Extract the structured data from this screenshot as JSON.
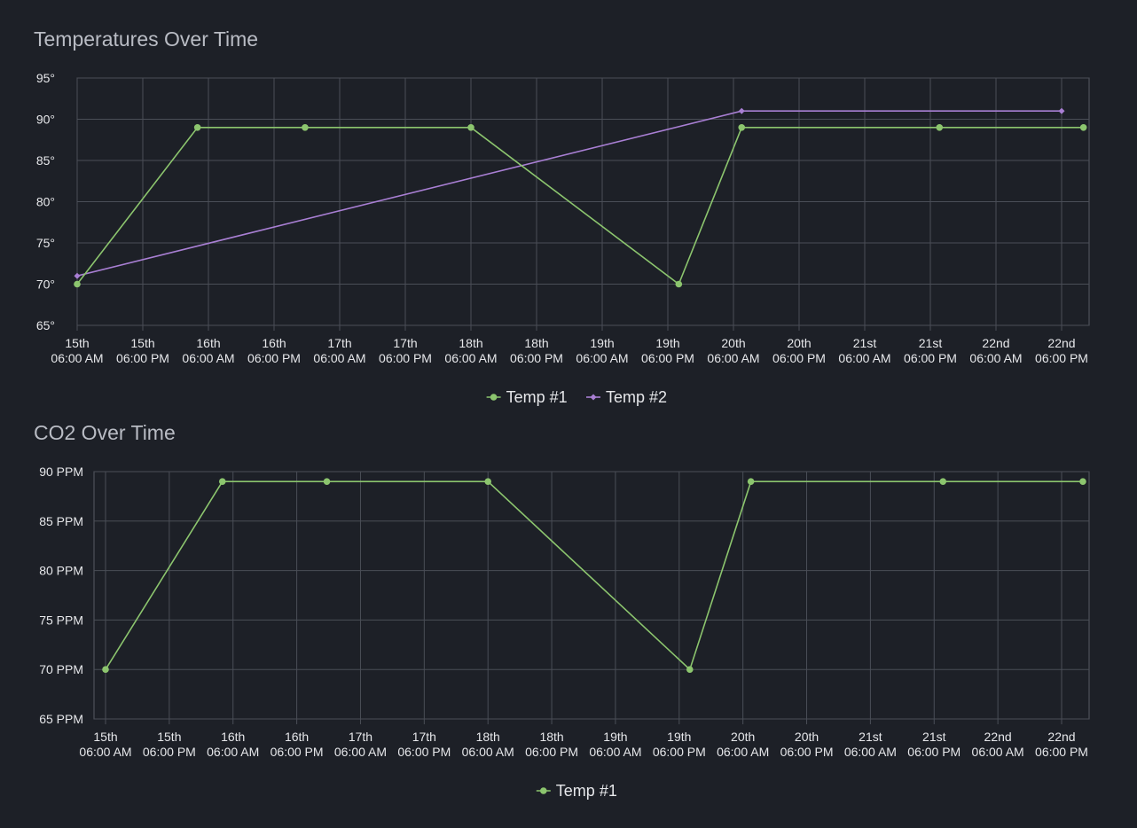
{
  "chart_data": [
    {
      "type": "line",
      "title": "Temperatures Over Time",
      "xlabel": "",
      "ylabel": "",
      "x_ticks": [
        [
          "15th",
          "06:00 AM"
        ],
        [
          "15th",
          "06:00 PM"
        ],
        [
          "16th",
          "06:00 AM"
        ],
        [
          "16th",
          "06:00 PM"
        ],
        [
          "17th",
          "06:00 AM"
        ],
        [
          "17th",
          "06:00 PM"
        ],
        [
          "18th",
          "06:00 AM"
        ],
        [
          "18th",
          "06:00 PM"
        ],
        [
          "19th",
          "06:00 AM"
        ],
        [
          "19th",
          "06:00 PM"
        ],
        [
          "20th",
          "06:00 AM"
        ],
        [
          "20th",
          "06:00 PM"
        ],
        [
          "21st",
          "06:00 AM"
        ],
        [
          "21st",
          "06:00 PM"
        ],
        [
          "22nd",
          "06:00 AM"
        ],
        [
          "22nd",
          "06:00 PM"
        ]
      ],
      "y_ticks": [
        "65°",
        "70°",
        "75°",
        "80°",
        "85°",
        "90°",
        "95°"
      ],
      "ylim": [
        65,
        95
      ],
      "xlim": [
        "15th 06:00 AM",
        "22nd 06:00 PM"
      ],
      "grid": true,
      "legend": "bottom-center",
      "series": [
        {
          "name": "Temp #1",
          "color": "#8cc56e",
          "marker": "circle",
          "points": [
            [
              "15th 06:00 AM",
              70
            ],
            [
              "16th 04:00 AM",
              89
            ],
            [
              "16th 11:40 PM",
              89
            ],
            [
              "18th 06:00 AM",
              89
            ],
            [
              "19th 08:00 PM",
              70
            ],
            [
              "20th 07:30 AM",
              89
            ],
            [
              "21st 07:40 PM",
              89
            ],
            [
              "22nd 10:00 PM",
              89
            ]
          ]
        },
        {
          "name": "Temp #2",
          "color": "#a97fd4",
          "marker": "diamond",
          "points": [
            [
              "15th 06:00 AM",
              71
            ],
            [
              "20th 07:30 AM",
              91
            ],
            [
              "22nd 06:00 PM",
              91
            ]
          ]
        }
      ]
    },
    {
      "type": "line",
      "title": "CO2 Over Time",
      "xlabel": "",
      "ylabel": "",
      "x_ticks": [
        [
          "15th",
          "06:00 AM"
        ],
        [
          "15th",
          "06:00 PM"
        ],
        [
          "16th",
          "06:00 AM"
        ],
        [
          "16th",
          "06:00 PM"
        ],
        [
          "17th",
          "06:00 AM"
        ],
        [
          "17th",
          "06:00 PM"
        ],
        [
          "18th",
          "06:00 AM"
        ],
        [
          "18th",
          "06:00 PM"
        ],
        [
          "19th",
          "06:00 AM"
        ],
        [
          "19th",
          "06:00 PM"
        ],
        [
          "20th",
          "06:00 AM"
        ],
        [
          "20th",
          "06:00 PM"
        ],
        [
          "21st",
          "06:00 AM"
        ],
        [
          "21st",
          "06:00 PM"
        ],
        [
          "22nd",
          "06:00 AM"
        ],
        [
          "22nd",
          "06:00 PM"
        ]
      ],
      "y_ticks": [
        "65 PPM",
        "70 PPM",
        "75 PPM",
        "80 PPM",
        "85 PPM",
        "90 PPM"
      ],
      "ylim": [
        65,
        90
      ],
      "xlim": [
        "15th 06:00 AM",
        "22nd 06:00 PM"
      ],
      "grid": true,
      "legend": "bottom-center",
      "series": [
        {
          "name": "Temp #1",
          "color": "#8cc56e",
          "marker": "circle",
          "points": [
            [
              "15th 06:00 AM",
              70
            ],
            [
              "16th 04:00 AM",
              89
            ],
            [
              "16th 11:40 PM",
              89
            ],
            [
              "18th 06:00 AM",
              89
            ],
            [
              "19th 08:00 PM",
              70
            ],
            [
              "20th 07:30 AM",
              89
            ],
            [
              "21st 07:40 PM",
              89
            ],
            [
              "22nd 10:00 PM",
              89
            ]
          ]
        }
      ]
    }
  ]
}
